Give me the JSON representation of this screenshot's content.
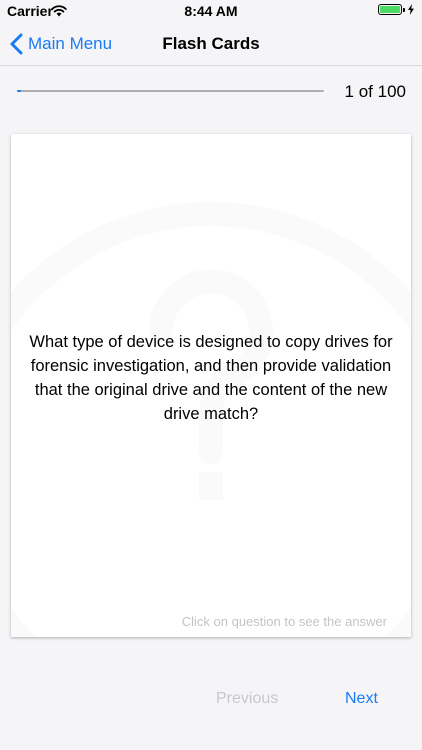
{
  "status_bar": {
    "carrier": "Carrier",
    "time": "8:44 AM",
    "battery_color": "#4cd964"
  },
  "nav": {
    "back_label": "Main Menu",
    "back_icon": "chevron-left-icon",
    "title": "Flash Cards"
  },
  "progress": {
    "label": "1 of 100",
    "current": 1,
    "total": 100
  },
  "card": {
    "watermark_icon": "question-mark-icon",
    "question": "What type of device is designed to copy drives for forensic investigation, and then provide validation that the original drive and the content of the new drive match?",
    "hint": "Click on question to see the answer"
  },
  "footer": {
    "previous_label": "Previous",
    "next_label": "Next"
  },
  "colors": {
    "accent": "#1a7cf5",
    "disabled": "#c8c8cc",
    "background": "#f5f5f7"
  }
}
